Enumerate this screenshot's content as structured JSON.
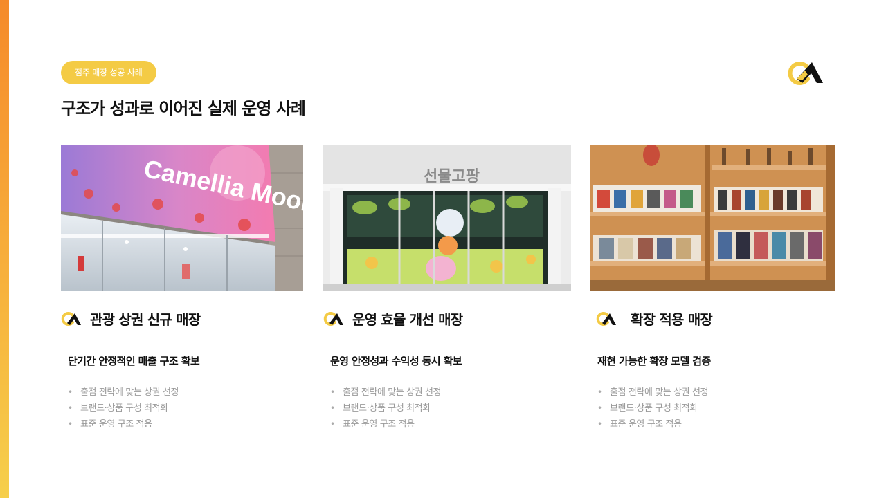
{
  "badge": "점주 매장 성공 사례",
  "title": "구조가 성과로 이어진 실제 운영 사례",
  "colors": {
    "accent": "#f4cb45",
    "side_bar_top": "#f58a2a",
    "side_bar_bottom": "#f6cf4b"
  },
  "cards": [
    {
      "image_sign": "Camellia Moon",
      "title": "관광 상권 신규 매장",
      "subtitle": "단기간 안정적인 매출 구조 확보",
      "bullets": [
        "출점 전략에 맞는 상권 선정",
        "브랜드·상품 구성 최적화",
        "표준 운영 구조 적용"
      ]
    },
    {
      "image_sign": "선물고팡",
      "title": "운영 효율 개선 매장",
      "subtitle": "운영 안정성과 수익성 동시 확보",
      "bullets": [
        "출점 전략에 맞는 상권 선정",
        "브랜드·상품 구성 최적화",
        "표준 운영 구조 적용"
      ]
    },
    {
      "image_sign": "",
      "title": "확장 적용 매장",
      "subtitle": "재현 가능한 확장 모델 검증",
      "bullets": [
        "출점 전략에 맞는 상권 선정",
        "브랜드·상품 구성 최적화",
        "표준 운영 구조 적용"
      ]
    }
  ]
}
